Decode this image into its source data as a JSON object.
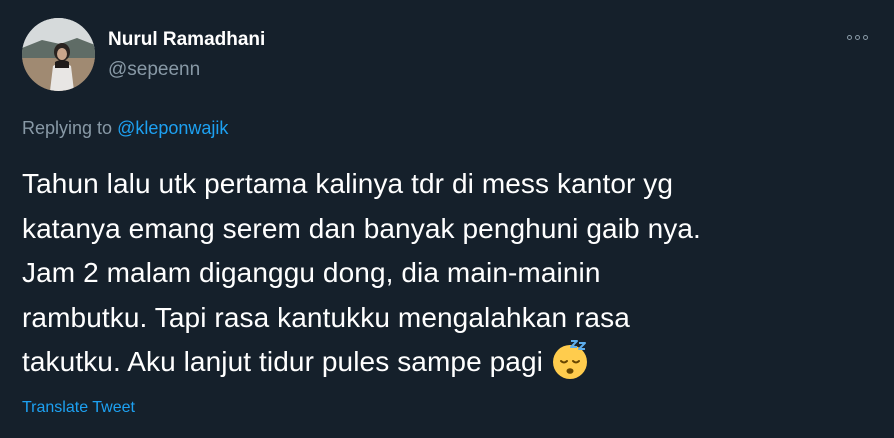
{
  "user": {
    "display_name": "Nurul Ramadhani",
    "handle": "@sepeenn"
  },
  "more_icon": "more-horizontal-icon",
  "reply": {
    "prefix": "Replying to ",
    "mention": "@kleponwajik"
  },
  "tweet": {
    "lines": [
      "Tahun lalu utk pertama kalinya tdr di mess kantor yg",
      "katanya emang serem dan banyak penghuni gaib nya.",
      "Jam 2 malam diganggu dong, dia main-mainin",
      "rambutku. Tapi rasa kantukku mengalahkan rasa",
      "takutku. Aku lanjut tidur pules sampe pagi"
    ],
    "emoji": "sleeping-face-icon"
  },
  "translate_label": "Translate Tweet",
  "colors": {
    "background": "#15202b",
    "text_primary": "#ffffff",
    "text_secondary": "#8899a6",
    "accent": "#1da1f2"
  }
}
